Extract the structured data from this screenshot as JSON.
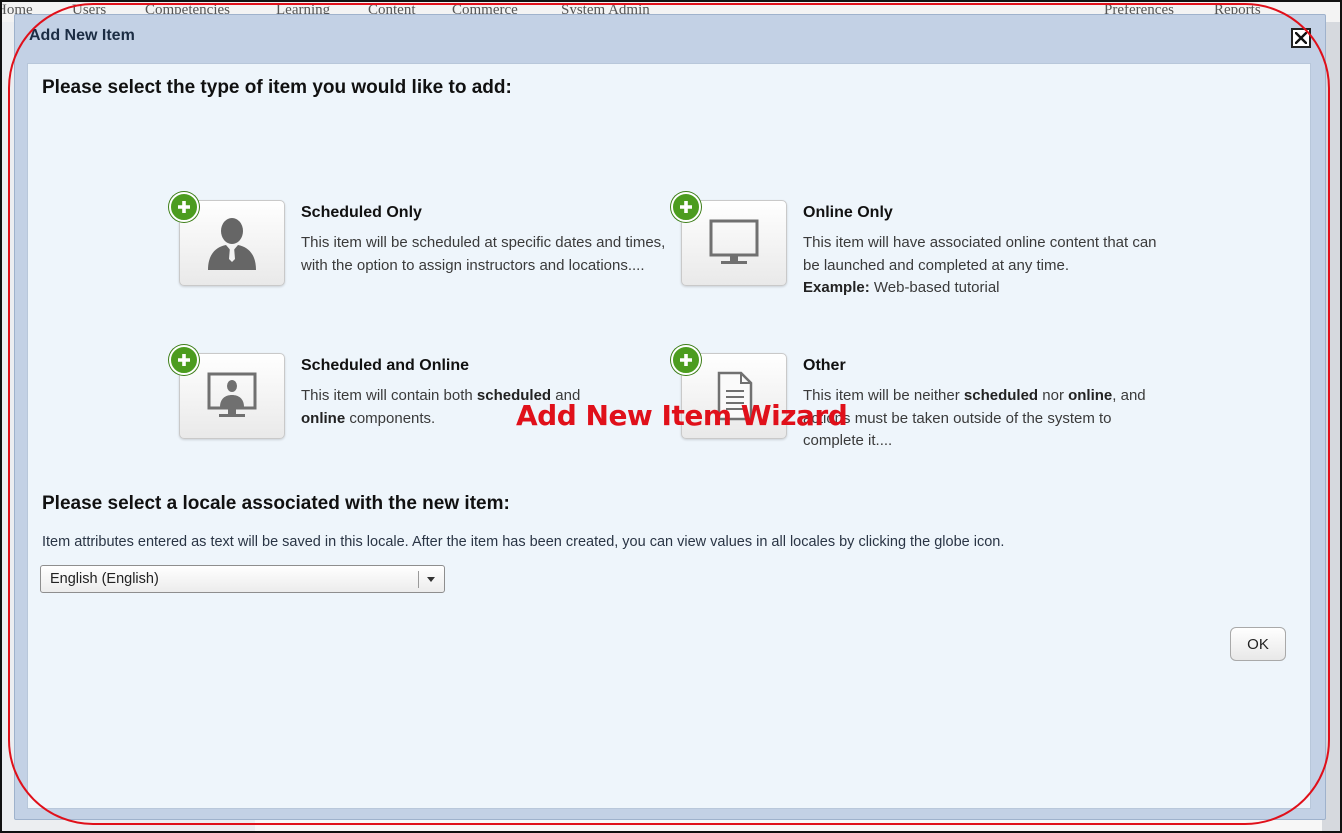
{
  "background": {
    "nav_items": [
      "Home",
      "Users",
      "Competencies",
      "Learning",
      "Content",
      "Commerce",
      "System Admin",
      "Preferences",
      "Reports"
    ]
  },
  "dialog": {
    "title": "Add New Item",
    "close_icon": "close-x-icon",
    "type_heading": "Please select the type of item you would like to add:",
    "options": [
      {
        "title": "Scheduled Only",
        "icon": "person-silhouette-icon",
        "desc": "This item will be scheduled at specific dates and times, with the option to assign instructors and locations...."
      },
      {
        "title": "Online Only",
        "icon": "monitor-icon",
        "desc": "This item will have associated online content that can be launched and completed at any time.",
        "example_label": "Example:",
        "example_text": " Web-based tutorial"
      },
      {
        "title": "Scheduled and Online",
        "icon": "presenter-on-screen-icon",
        "desc_parts": [
          "This item will contain both ",
          "scheduled",
          " and ",
          "online",
          " components."
        ]
      },
      {
        "title": "Other",
        "icon": "document-icon",
        "desc_parts": [
          "This item will be neither ",
          "scheduled",
          " nor ",
          "online",
          ", and actions must be taken outside of the system to complete it...."
        ]
      }
    ],
    "locale_heading": "Please select a locale associated with the new item:",
    "locale_note": "Item attributes entered as text will be saved in this locale. After the item has been created, you can view values in all locales by clicking the globe icon.",
    "locale_selected": "English (English)",
    "ok_label": "OK"
  },
  "annotation": {
    "label": "Add New Item Wizard",
    "color": "#e0101a"
  },
  "colors": {
    "dialog_header": "#c3d1e5",
    "dialog_body": "#eef5fb",
    "plus_badge": "#4c9c1f"
  }
}
